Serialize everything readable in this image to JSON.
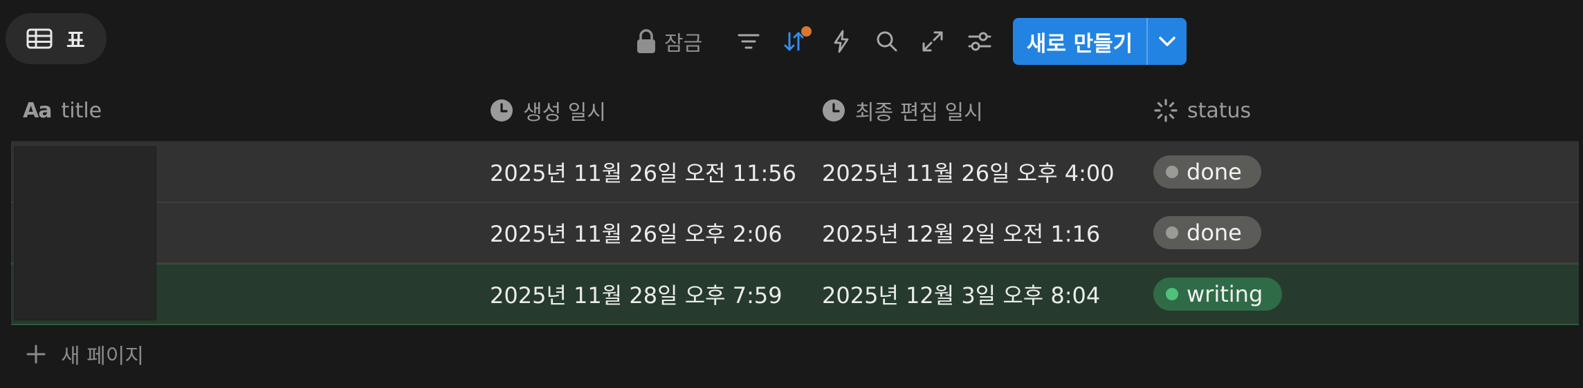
{
  "view": {
    "tab_label": "표",
    "tab_icon": "table-icon"
  },
  "toolbar": {
    "lock_label": "잠금",
    "icons": [
      "lock-icon",
      "filter-icon",
      "sort-icon",
      "lightning-icon",
      "search-icon",
      "expand-icon",
      "settings-icon"
    ],
    "sort_badge_color": "#d9772f",
    "new_button_label": "새로 만들기",
    "new_button_color": "#2383e2"
  },
  "columns": [
    {
      "label": "title",
      "icon": "text-property-icon"
    },
    {
      "label": "생성 일시",
      "icon": "clock-icon"
    },
    {
      "label": "최종 편집 일시",
      "icon": "clock-icon"
    },
    {
      "label": "status",
      "icon": "status-icon"
    }
  ],
  "rows": [
    {
      "title": "",
      "created": "2025년 11월 26일 오전 11:56",
      "edited": "2025년 11월 26일 오후 4:00",
      "status": "done"
    },
    {
      "title": "",
      "created": "2025년 11월 26일 오후 2:06",
      "edited": "2025년 12월 2일 오전 1:16",
      "status": "done"
    },
    {
      "title": "",
      "created": "2025년 11월 28일 오후 7:59",
      "edited": "2025년 12월 3일 오후 8:04",
      "status": "writing"
    }
  ],
  "status_colors": {
    "done": "#5b5b58",
    "writing": "#2f6b47"
  },
  "add_page_label": "새 페이지"
}
